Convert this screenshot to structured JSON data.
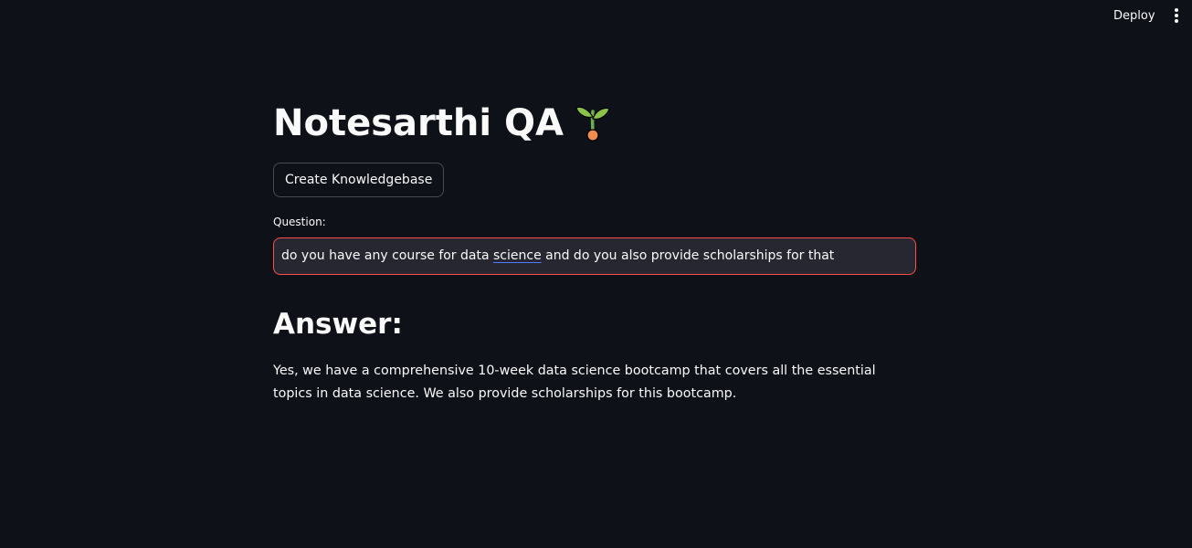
{
  "header": {
    "deploy_label": "Deploy",
    "menu_icon": "kebab-menu-icon"
  },
  "main": {
    "title": "Notesarthi QA",
    "title_icon": "seedling-icon",
    "create_kb_label": "Create Knowledgebase",
    "question_label": "Question:",
    "question_value_parts": [
      "do you have any course for data ",
      "science",
      " and do you also provide scholarships for that"
    ],
    "answer_heading": "Answer:",
    "answer_text": "Yes, we have a comprehensive 10-week data science bootcamp that covers all the essential topics in data science. We also provide scholarships for this bootcamp."
  },
  "colors": {
    "background": "#0e1117",
    "text": "#fafafa",
    "input_background": "#262730",
    "input_focus_border": "#ff4b4b",
    "spellcheck_underline": "#4d7cff"
  }
}
